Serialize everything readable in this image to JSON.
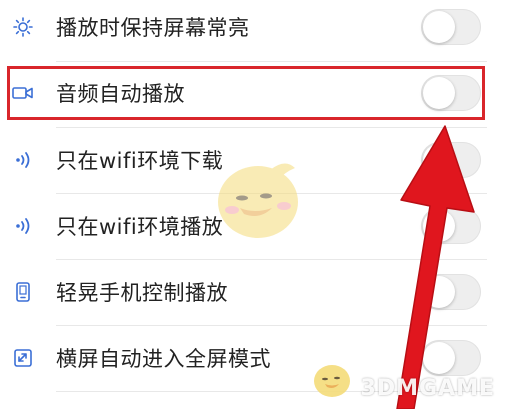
{
  "settings": {
    "items": [
      {
        "label": "播放时保持屏幕常亮",
        "icon": "sun-icon",
        "enabled": false
      },
      {
        "label": "音频自动播放",
        "icon": "video-camera-icon",
        "enabled": false
      },
      {
        "label": "只在wifi环境下载",
        "icon": "signal-waves-icon",
        "enabled": false
      },
      {
        "label": "只在wifi环境播放",
        "icon": "signal-waves-icon",
        "enabled": false
      },
      {
        "label": "轻晃手机控制播放",
        "icon": "phone-icon",
        "enabled": false
      },
      {
        "label": "横屏自动进入全屏模式",
        "icon": "expand-icon",
        "enabled": false
      }
    ]
  },
  "watermark": {
    "text": "3DMGAME"
  },
  "colors": {
    "accent_icon": "#3b6fd6",
    "highlight_border": "#d9262b",
    "arrow": "#e0161e"
  }
}
